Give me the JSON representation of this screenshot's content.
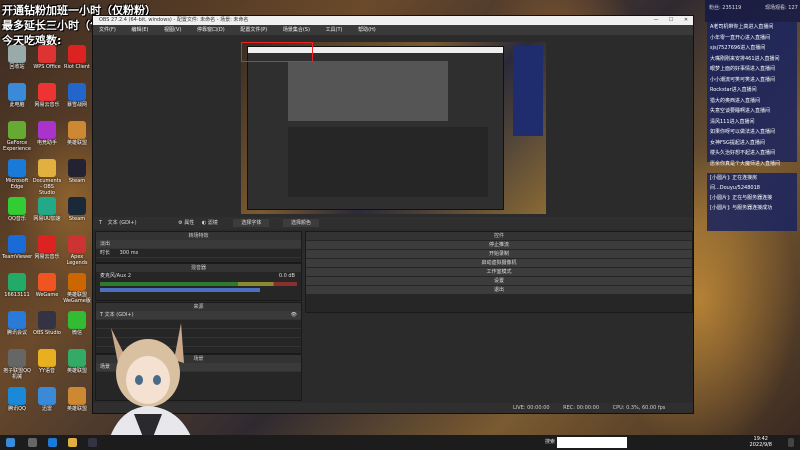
{
  "overlay": {
    "line1": "开通钻粉加班一小时（仅粉粉）",
    "line2": "最多延长三小时（包括其他）",
    "line3": "今天吃鸡数:"
  },
  "desktop_icons": [
    {
      "label": "回收站",
      "color": "#9aa"
    },
    {
      "label": "WPS Office",
      "color": "#d33"
    },
    {
      "label": "Riot Client",
      "color": "#d22"
    },
    {
      "label": "此电脑",
      "color": "#3a8ad8"
    },
    {
      "label": "网易云音乐",
      "color": "#e33"
    },
    {
      "label": "暴雪战网",
      "color": "#2266cc"
    },
    {
      "label": "GeForce Experience",
      "color": "#6a3"
    },
    {
      "label": "电竞助手",
      "color": "#a3c"
    },
    {
      "label": "英雄联盟",
      "color": "#c83"
    },
    {
      "label": "Microsoft Edge",
      "color": "#1a7ad8"
    },
    {
      "label": "Documents - OBS Studio",
      "color": "#e0b040"
    },
    {
      "label": "Steam",
      "color": "#223"
    },
    {
      "label": "QQ音乐",
      "color": "#3c3"
    },
    {
      "label": "网易UU加速",
      "color": "#2a8"
    },
    {
      "label": "Steam",
      "color": "#1b2838"
    },
    {
      "label": "TeamViewer",
      "color": "#1a6ad8"
    },
    {
      "label": "网易云音乐",
      "color": "#d22"
    },
    {
      "label": "Apex Legends",
      "color": "#c33"
    },
    {
      "label": "16613111",
      "color": "#2a6"
    },
    {
      "label": "WeGame",
      "color": "#e52"
    },
    {
      "label": "英雄联盟WeGame版",
      "color": "#c60"
    },
    {
      "label": "腾讯会议",
      "color": "#2a7ad8"
    },
    {
      "label": "OBS Studio",
      "color": "#334"
    },
    {
      "label": "微信",
      "color": "#3b3"
    },
    {
      "label": "孢子联盟QQ 机械",
      "color": "#666"
    },
    {
      "label": "YY语音",
      "color": "#e8b020"
    },
    {
      "label": "英雄联盟",
      "color": "#3a6"
    },
    {
      "label": "腾讯QQ",
      "color": "#1a8ad8"
    },
    {
      "label": "迅雷",
      "color": "#3a8ad8"
    },
    {
      "label": "英雄联盟",
      "color": "#c83"
    }
  ],
  "obs": {
    "title": "OBS 27.2.4 (64-bit, windows) - 配置文件: 未命名 - 场景: 未命名",
    "menu": [
      "文件(F)",
      "编辑(E)",
      "视图(V)",
      "停靠窗口(D)",
      "配置文件(P)",
      "场景集合(S)",
      "工具(T)",
      "帮助(H)"
    ],
    "source_bar": {
      "source": "文本 (GDI+)",
      "properties": "属性",
      "filters": "滤镜",
      "select_font": "选择字体",
      "select_color": "选择颜色"
    },
    "docks": {
      "transitions": "转场特效",
      "audio_mixer": "混音器",
      "scenes": "场景",
      "sources": "来源",
      "controls": "控件"
    },
    "transition": {
      "type": "淡出",
      "duration_label": "时长",
      "duration": "300 ms"
    },
    "mixer_track": {
      "name": "麦克风/Aux 2",
      "level": "0.0 dB"
    },
    "sources_list": [
      "文本 (GDI+)",
      "",
      "",
      ""
    ],
    "scene_item": "场景",
    "controls": [
      "停止推流",
      "开始录制",
      "启动虚拟摄像机",
      "工作室模式",
      "设置",
      "退出"
    ],
    "status": {
      "live": "LIVE: 00:00:00",
      "rec": "REC: 00:00:00",
      "cpu": "CPU: 0.3%, 60.00 fps"
    }
  },
  "chat": {
    "top_left": "粉丝: 235119",
    "top_right": "现场观看: 127",
    "messages": [
      "A老司机带你上高进入直播间",
      "小年零一直开心进入直播间",
      "sjsj7527696进入直播间",
      "大嘴刚刚来安排461进入直播间",
      "眼梦上面的好事情进入直播间",
      "小小潮流可笑可笑进入直播间",
      "Rockstar进入直播间",
      "猎大的奥西进入直播间",
      "失意空谈要睡啊进入直播间",
      "清风111进入直播间",
      "如果你呀可以做法进入直播间",
      "女神FSG提起进入直播间",
      "楼头久治好想不起进入直播间",
      "愿余你真是个大魔师进入直播间"
    ],
    "gifts": [
      "[小圆片]: 正在连接房",
      "间...Douyu/5248018",
      "[小圆片]: 正在与服务器连接",
      "[小圆片]: 与服务器连接成功"
    ]
  },
  "taskbar": {
    "search_label": "搜索",
    "time": "19:42",
    "date": "2022/9/8"
  }
}
